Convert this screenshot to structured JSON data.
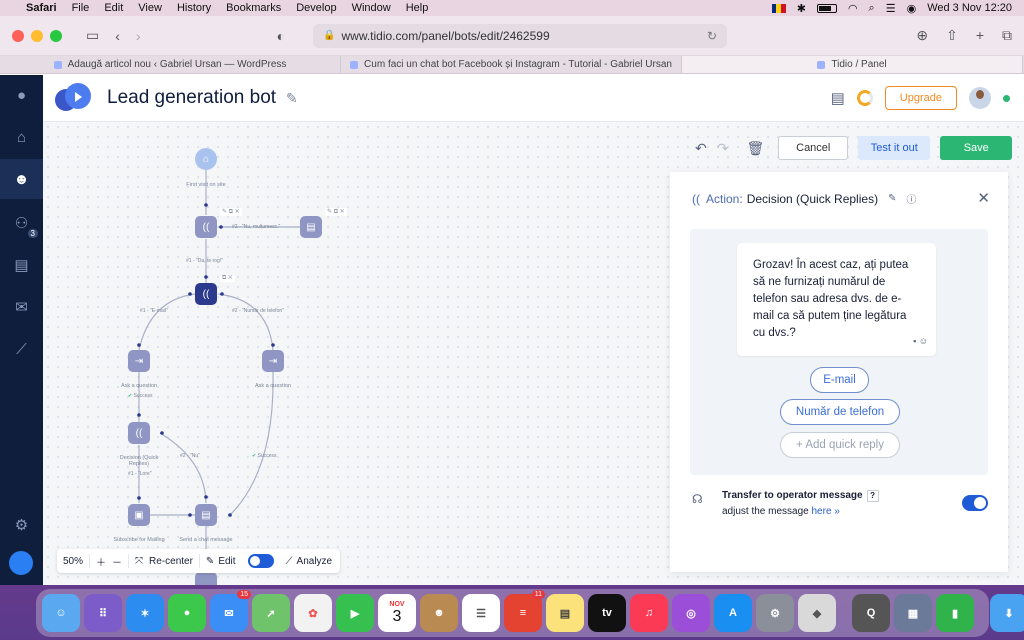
{
  "menubar": {
    "app": "Safari",
    "items": [
      "File",
      "Edit",
      "View",
      "History",
      "Bookmarks",
      "Develop",
      "Window",
      "Help"
    ],
    "clock": "Wed 3 Nov  12:20"
  },
  "browser": {
    "url": "www.tidio.com/panel/bots/edit/2462599",
    "tabs": [
      "Adaugă articol nou ‹ Gabriel Ursan — WordPress",
      "Cum faci un chat bot Facebook și Instagram - Tutorial - Gabriel Ursan",
      "Tidio / Panel"
    ]
  },
  "sidebar": {
    "items": [
      {
        "icon": "chat-icon"
      },
      {
        "icon": "home-icon"
      },
      {
        "icon": "bot-icon",
        "active": true
      },
      {
        "icon": "visitors-icon",
        "badge": "3"
      },
      {
        "icon": "contacts-icon"
      },
      {
        "icon": "mail-icon"
      },
      {
        "icon": "analytics-icon"
      },
      {
        "icon": "settings-icon"
      }
    ]
  },
  "header": {
    "title": "Lead generation bot",
    "upgrade_label": "Upgrade"
  },
  "toolbar": {
    "cancel_label": "Cancel",
    "test_label": "Test it out",
    "save_label": "Save"
  },
  "flow": {
    "nodes": {
      "start": "First visit on site",
      "ask1": "Ask a question",
      "ask2": "Ask a question",
      "decision2": "Decision (Quick Replies)",
      "subscribe": "Subscribe for Mailing",
      "send": "Send a chat message"
    },
    "edges": {
      "e1": "#2 - \"Nu, mulțumesc.\"",
      "e2": "#1 - \"Da, te rog!\"",
      "e3": "#1 - \"E-mail\"",
      "e4": "#2 - \"Număr de telefon\"",
      "e5": "#2 - \"Nu\"",
      "e6": "#1 - \"Lore\"",
      "success1": "Success",
      "success2": "Success"
    }
  },
  "zoombar": {
    "zoom": "50%",
    "recenter_label": "Re-center",
    "edit_label": "Edit",
    "analyze_label": "Analyze"
  },
  "panel": {
    "action_label": "Action:",
    "action_name": "Decision (Quick Replies)",
    "message": "Grozav! În acest caz, ați putea să ne furnizați numărul de telefon sau adresa dvs. de e-mail ca să putem ține legătura cu dvs.?",
    "quick_replies": [
      "E-mail",
      "Număr de telefon"
    ],
    "add_quick_reply": "+  Add quick reply",
    "transfer_title": "Transfer to operator message",
    "transfer_sub": "adjust the message",
    "transfer_link": "here »"
  },
  "dock": {
    "calendar_month": "NOV",
    "calendar_day": "3",
    "mail_badge": "15",
    "todoist_badge": "11"
  },
  "colors": {
    "accent": "#1f5bd6",
    "save": "#2bb673",
    "upgrade": "#f08a24",
    "sidebar": "#0f1e3d"
  }
}
